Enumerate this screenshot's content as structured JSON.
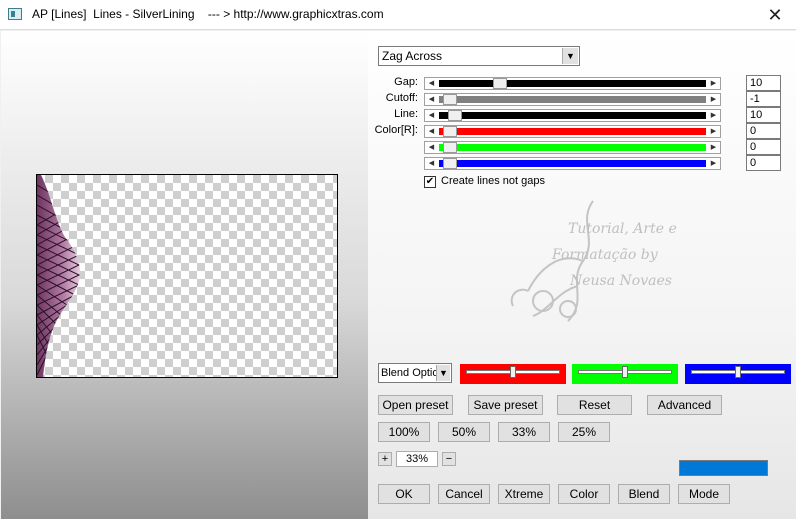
{
  "window": {
    "title": "AP [Lines]  Lines - SilverLining    --- > http://www.graphicxtras.com",
    "close_glyph": "✕"
  },
  "mode_dropdown": {
    "selected": "Zag Across"
  },
  "sliders": [
    {
      "label": "Gap:",
      "value": "10",
      "thumb_fraction": 0.23,
      "color": "#000000"
    },
    {
      "label": "Cutoff:",
      "value": "-1",
      "thumb_fraction": 0.04,
      "color": "#808080"
    },
    {
      "label": "Line:",
      "value": "10",
      "thumb_fraction": 0.06,
      "color": "#000000"
    },
    {
      "label": "Color[R]:",
      "value": "0",
      "thumb_fraction": 0.04,
      "color": "#ff0000"
    },
    {
      "label": "",
      "value": "0",
      "thumb_fraction": 0.04,
      "color": "#00ff00"
    },
    {
      "label": "",
      "value": "0",
      "thumb_fraction": 0.04,
      "color": "#0000ff"
    }
  ],
  "create_lines": {
    "checked": true,
    "check_glyph": "✔",
    "label": "Create lines not gaps"
  },
  "watermark": {
    "line1": "Tutorial, Arte e",
    "line2": "Formatação by",
    "line3": "Neusa Novaes"
  },
  "blend_options": {
    "selected": "Blend Options"
  },
  "color_channels": [
    {
      "color": "#ff0000",
      "thumb_fraction": 0.5
    },
    {
      "color": "#00ff00",
      "thumb_fraction": 0.5
    },
    {
      "color": "#0000ff",
      "thumb_fraction": 0.5
    }
  ],
  "preset_buttons": {
    "open": "Open preset",
    "save": "Save preset",
    "reset": "Reset",
    "advanced": "Advanced"
  },
  "zoom_buttons": [
    "100%",
    "50%",
    "33%",
    "25%"
  ],
  "zoom": {
    "plus": "+",
    "minus": "−",
    "value": "33%"
  },
  "indicator_color": "#0078d7",
  "bottom_buttons": {
    "ok": "OK",
    "cancel": "Cancel",
    "xtreme": "Xtreme",
    "color": "Color",
    "blend": "Blend",
    "mode": "Mode"
  },
  "preview": {
    "shape_color": "#8b4f7a"
  }
}
